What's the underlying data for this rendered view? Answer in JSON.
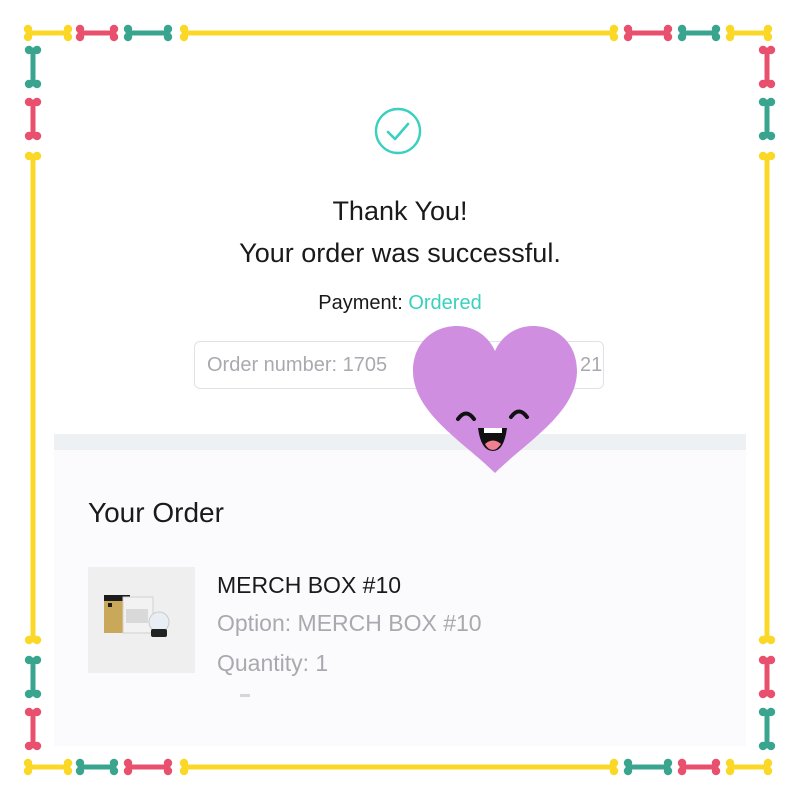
{
  "frame_colors": {
    "yellow": "#fbd826",
    "pink": "#e8506e",
    "teal": "#3aa58f"
  },
  "confirmation": {
    "icon": "checkmark-circle-icon",
    "accent_color": "#39d0c0",
    "heading_line1": "Thank You!",
    "heading_line2": "Your order was successful.",
    "payment_label": "Payment:",
    "payment_status": "Ordered",
    "order_number_visible": "Order number: 1705",
    "order_number_tail": "21"
  },
  "order": {
    "section_title": "Your Order",
    "items": [
      {
        "name": "MERCH BOX #10",
        "option": "Option: MERCH BOX #10",
        "quantity": "Quantity: 1",
        "thumbnail": "merch-box-product-photo"
      }
    ]
  },
  "overlay": {
    "sticker": "smiling-purple-heart-sticker",
    "color": "#d08ee0"
  }
}
